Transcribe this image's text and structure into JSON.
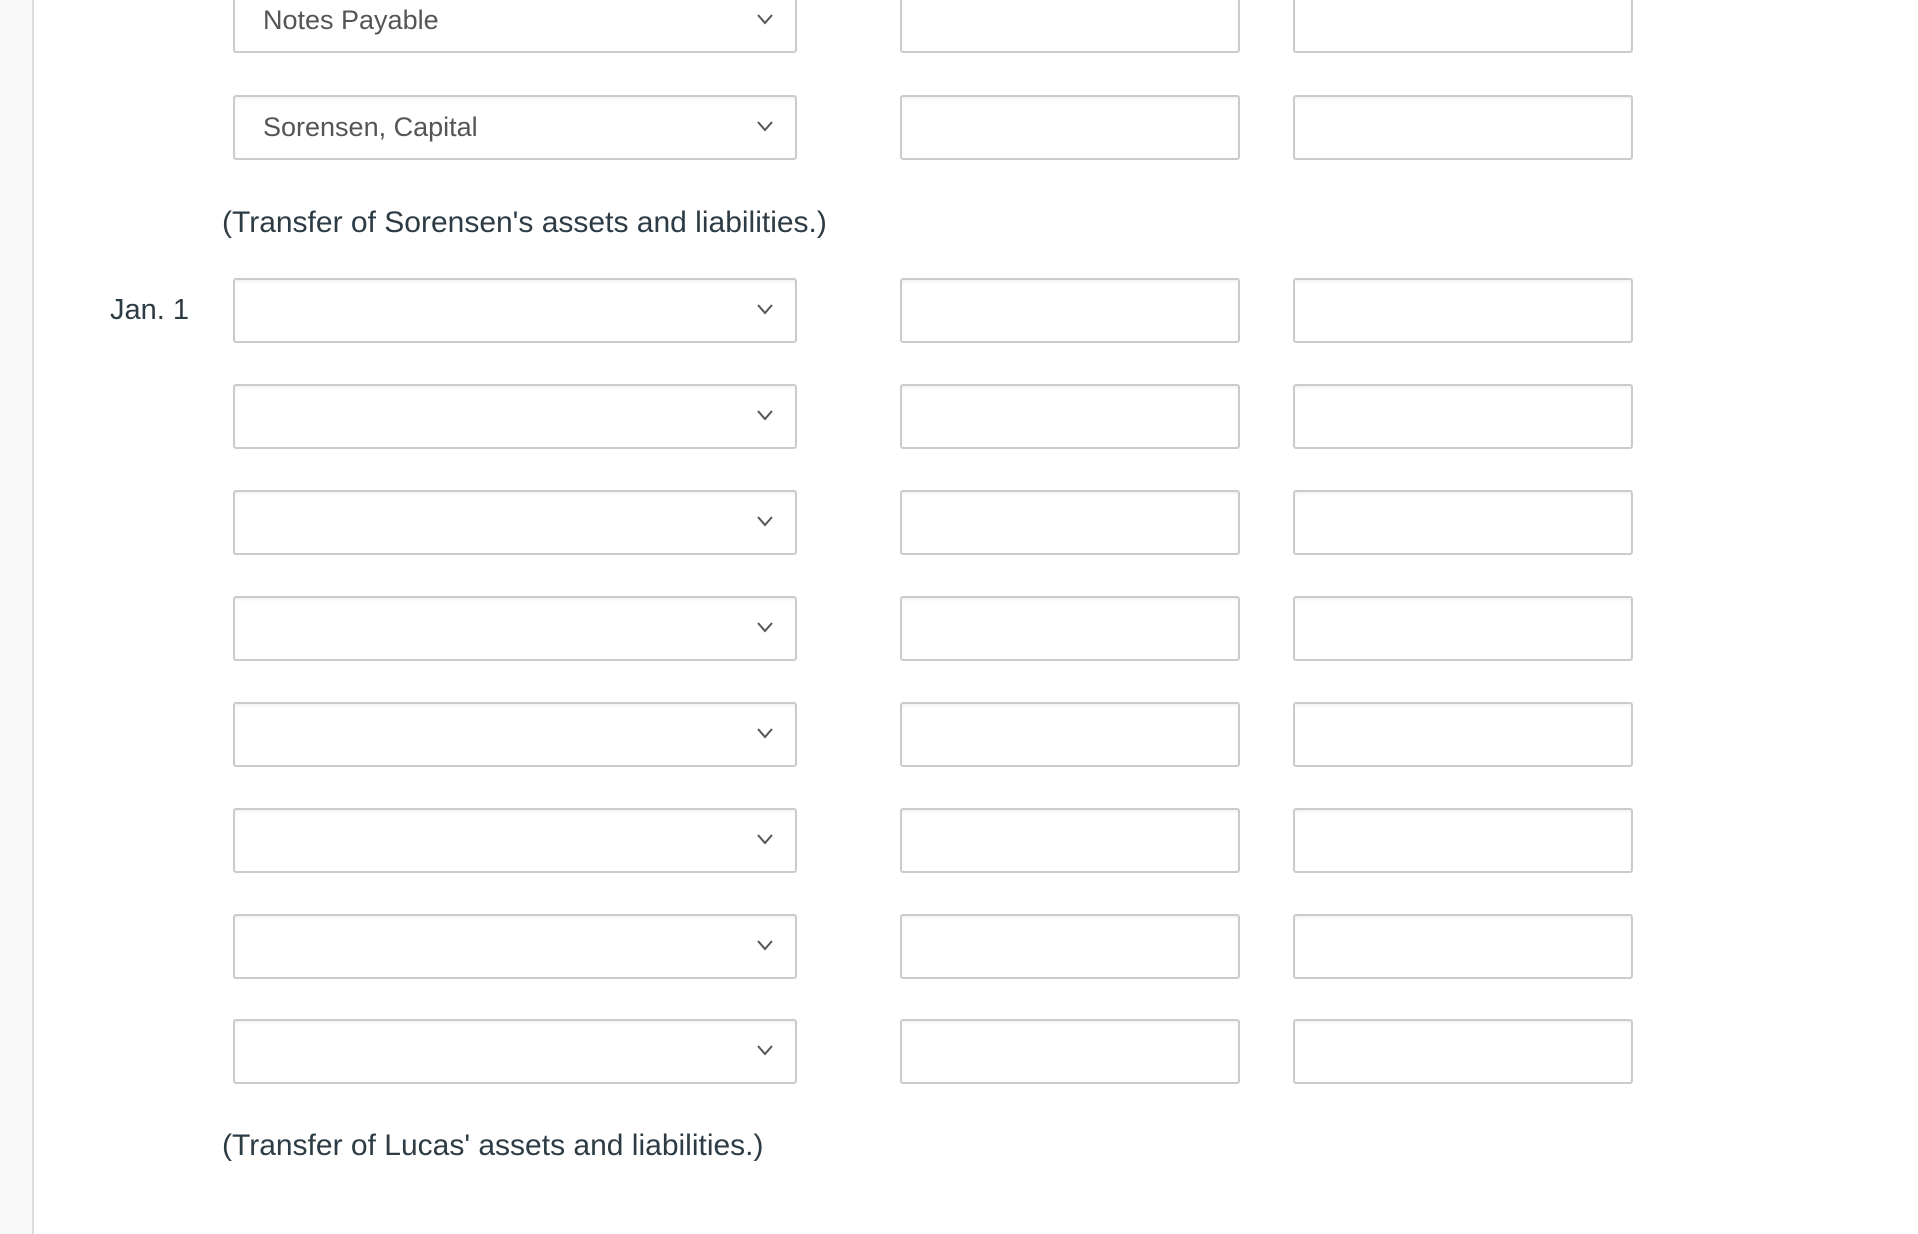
{
  "journal": {
    "groups": [
      {
        "date": "",
        "rows": [
          {
            "account": "Notes Payable",
            "debit": "",
            "credit": ""
          },
          {
            "account": "Sorensen, Capital",
            "debit": "",
            "credit": ""
          }
        ],
        "annotation": "(Transfer of Sorensen's assets and liabilities.)"
      },
      {
        "date": "Jan. 1",
        "rows": [
          {
            "account": "",
            "debit": "",
            "credit": ""
          },
          {
            "account": "",
            "debit": "",
            "credit": ""
          },
          {
            "account": "",
            "debit": "",
            "credit": ""
          },
          {
            "account": "",
            "debit": "",
            "credit": ""
          },
          {
            "account": "",
            "debit": "",
            "credit": ""
          },
          {
            "account": "",
            "debit": "",
            "credit": ""
          },
          {
            "account": "",
            "debit": "",
            "credit": ""
          },
          {
            "account": "",
            "debit": "",
            "credit": ""
          }
        ],
        "annotation": "(Transfer of Lucas' assets and liabilities.)"
      }
    ]
  },
  "icons": {
    "select_chevron": "chevron-down-icon"
  },
  "colors": {
    "text": "#2d3b45",
    "select_text": "#555555",
    "border": "#cbcbcb",
    "gutter": "#f9f9f9"
  }
}
